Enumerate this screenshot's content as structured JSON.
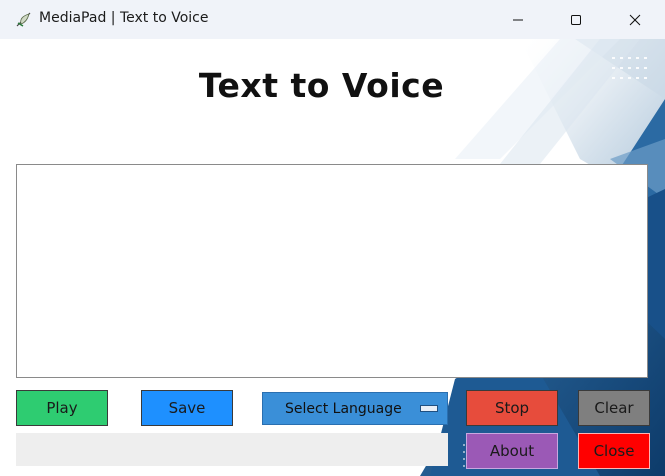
{
  "window": {
    "title": "MediaPad | Text to Voice",
    "minimize_icon": "minimize-icon",
    "maximize_icon": "maximize-icon",
    "close_icon": "close-icon"
  },
  "header": {
    "heading": "Text to Voice"
  },
  "editor": {
    "value": ""
  },
  "controls": {
    "play_label": "Play",
    "save_label": "Save",
    "language_label": "Select Language",
    "stop_label": "Stop",
    "clear_label": "Clear",
    "about_label": "About",
    "close_label": "Close"
  },
  "status": {
    "text": ""
  },
  "colors": {
    "play": "#2ecc71",
    "save": "#1e90ff",
    "language": "#3a8fd8",
    "stop": "#e74c3c",
    "clear": "#7f7f7f",
    "about": "#9b59b6",
    "close": "#ff0000",
    "accent_background": "#1f5fa0"
  }
}
